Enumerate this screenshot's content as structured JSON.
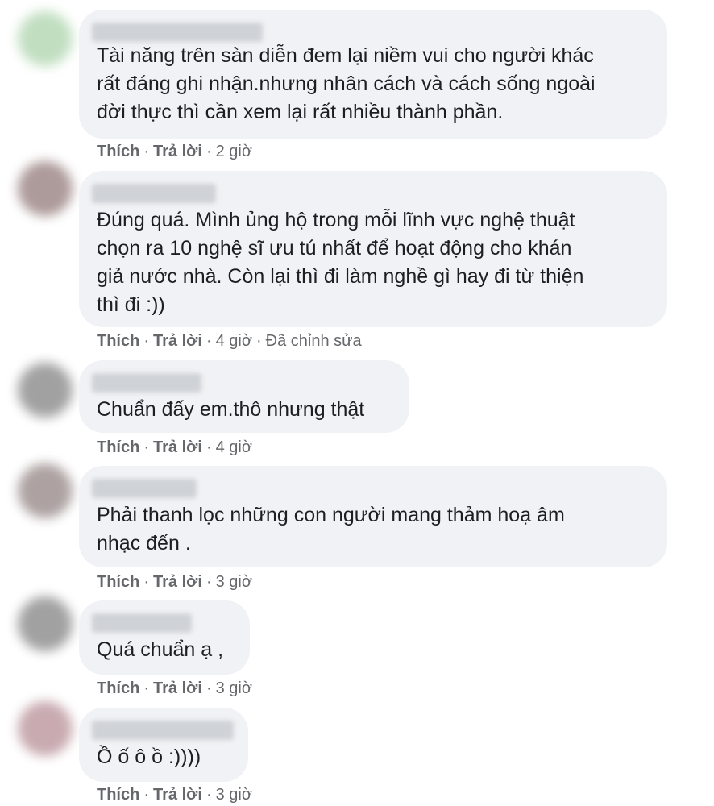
{
  "actions": {
    "like": "Thích",
    "reply": "Trả lời",
    "edited": "Đã chỉnh sửa"
  },
  "comments": [
    {
      "text": "Tài năng trên sàn diễn đem lại niềm vui cho người khác\nrất đáng ghi nhận.nhưng nhân cách và cách sống ngoài\nđời thực thì cần xem lại rất nhiều thành phần.",
      "time": "2 giờ",
      "avatar_color": "#8fc48f"
    },
    {
      "text": "Đúng quá. Mình ủng hộ trong mỗi lĩnh vực nghệ thuật\nchọn ra 10 nghệ sĩ ưu tú nhất để hoạt động cho khán\ngiả nước nhà. Còn lại thì đi làm nghề gì hay đi từ thiện\nthì đi :))",
      "time": "4 giờ",
      "avatar_color": "#6b4848"
    },
    {
      "text": "Chuẩn đấy em.thô nhưng thật",
      "time": "4 giờ",
      "avatar_color": "#555555"
    },
    {
      "text": "Phải thanh lọc những con người mang thảm hoạ âm\nnhạc đến .",
      "time": "3 giờ",
      "avatar_color": "#6b5656"
    },
    {
      "text": "Quá chuẩn ạ ,",
      "time": "3 giờ",
      "avatar_color": "#555555"
    },
    {
      "text": "Ồ ố ô ồ :))))",
      "time": "3 giờ",
      "avatar_color": "#9c6670"
    }
  ]
}
